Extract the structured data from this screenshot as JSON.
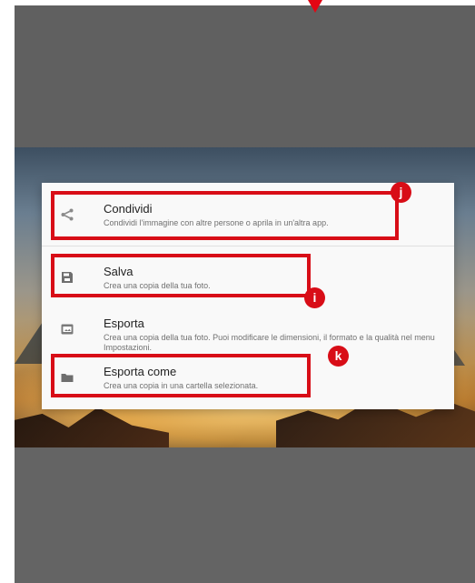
{
  "dialog": {
    "items": [
      {
        "title": "Condividi",
        "description": "Condividi l'immagine con altre persone o aprila in un'altra app.",
        "icon": "share-icon"
      },
      {
        "title": "Salva",
        "description": "Crea una copia della tua foto.",
        "icon": "save-icon"
      },
      {
        "title": "Esporta",
        "description": "Crea una copia della tua foto. Puoi modificare le dimensioni, il formato e la qualità nel menu Impostazioni.",
        "icon": "jpg-icon"
      },
      {
        "title": "Esporta come",
        "description": "Crea una copia in una cartella selezionata.",
        "icon": "folder-icon"
      }
    ]
  },
  "annotations": {
    "j": "j",
    "i": "i",
    "k": "k"
  },
  "colors": {
    "highlight": "#d80d17",
    "overlay": "#606060"
  }
}
